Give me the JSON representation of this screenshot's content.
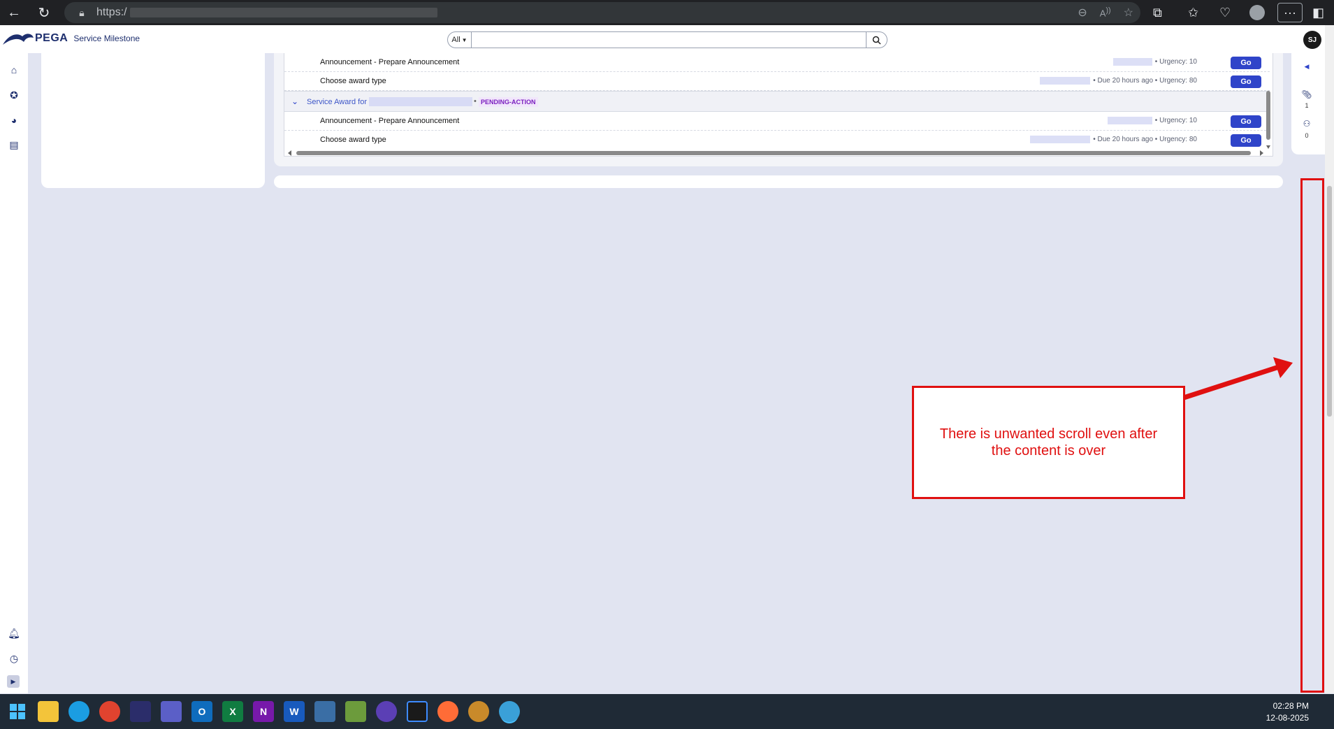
{
  "browser": {
    "url_prefix": "https:/",
    "nav_icons": [
      "back-arrow-icon",
      "reload-icon",
      "lock-icon"
    ],
    "addr_icons": [
      "zoom-out-icon",
      "read-aloud-icon",
      "favorite-star-icon"
    ],
    "toolbar_icons": [
      "extensions-icon",
      "favorites-icon",
      "browser-essentials-icon",
      "profile-icon",
      "more-menu-icon",
      "sidebar-icon"
    ]
  },
  "header": {
    "brand": "PEGA",
    "app_name": "Service Milestone",
    "search_scope": "All",
    "search_placeholder": "",
    "avatar_initials": "SJ"
  },
  "worklist": {
    "rows_top": [
      {
        "title": "Announcement - Prepare Announcement",
        "meta": "• Urgency: 10",
        "action": "Go"
      },
      {
        "title": "Choose award type",
        "meta": "• Due 20 hours ago • Urgency: 80",
        "action": "Go"
      }
    ],
    "group": {
      "link_text": "Service Award for",
      "status": "PENDING-ACTION"
    },
    "rows_bottom": [
      {
        "title": "Announcement - Prepare Announcement",
        "meta": "• Urgency: 10",
        "action": "Go"
      },
      {
        "title": "Choose award type",
        "meta": "• Due 20 hours ago • Urgency: 80",
        "action": "Go"
      }
    ]
  },
  "right_util": {
    "attachments_count": "1",
    "followers_count": "0"
  },
  "annotation": {
    "note": "There is unwanted scroll even after the content is over",
    "color": "#e01010"
  },
  "taskbar": {
    "apps": [
      "windows-start-icon",
      "file-explorer-icon",
      "edge-icon",
      "chrome-icon",
      "webex-icon",
      "teams-icon",
      "outlook-icon",
      "excel-icon",
      "onenote-icon",
      "word-icon",
      "monitor-app-icon",
      "notepad-icon",
      "github-icon",
      "intellij-icon",
      "postman-icon",
      "app-icon",
      "edge-active-icon"
    ],
    "time": "02:28 PM",
    "date": "12-08-2025"
  }
}
